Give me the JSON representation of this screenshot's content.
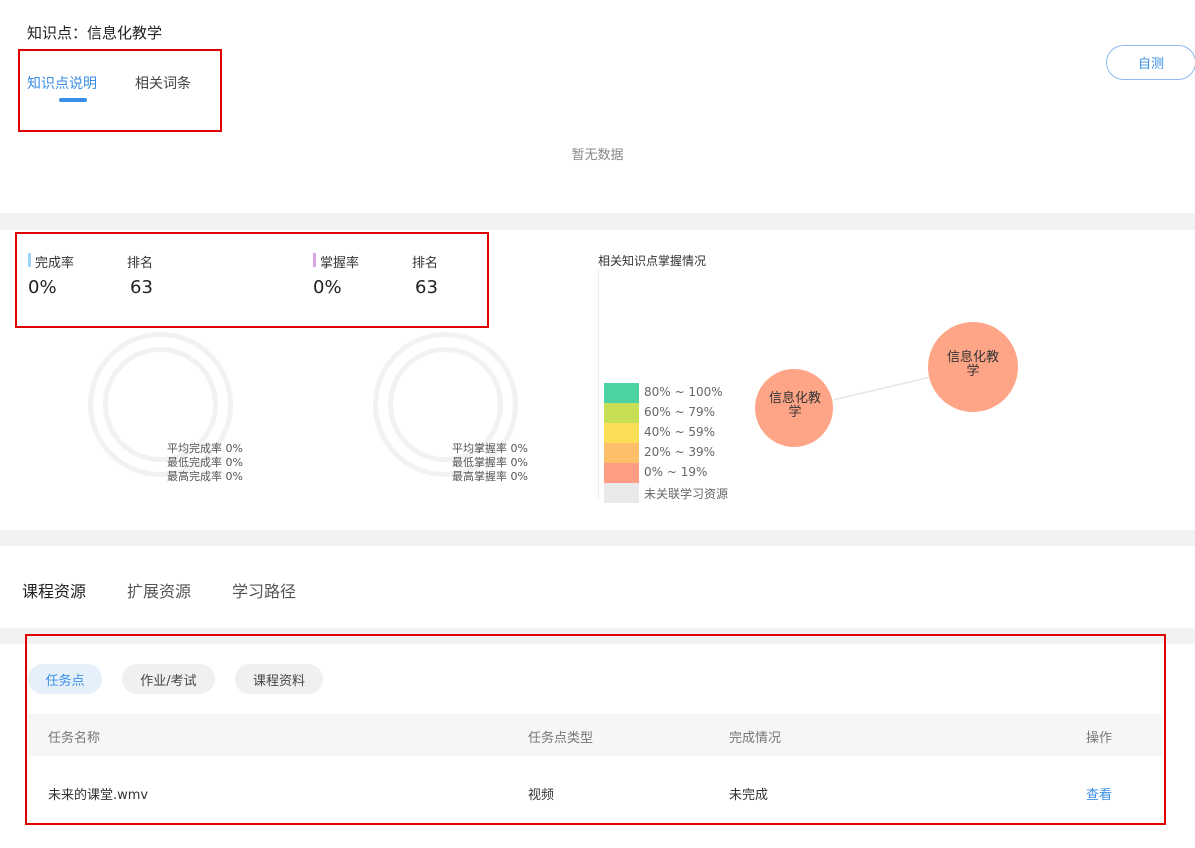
{
  "knowledge_point": {
    "label": "知识点：信息化教学"
  },
  "tabs": [
    {
      "label": "知识点说明",
      "active": true
    },
    {
      "label": "相关词条",
      "active": false
    }
  ],
  "selftest_label": "自测",
  "empty_text": "暂无数据",
  "stats": {
    "completion": {
      "label": "完成率",
      "value": "0%",
      "rank_label": "排名",
      "rank": "63",
      "color": "#9fd3f5"
    },
    "mastery": {
      "label": "掌握率",
      "value": "0%",
      "rank_label": "排名",
      "rank": "63",
      "color": "#d9a3e6"
    }
  },
  "completion_summary": [
    "平均完成率 0%",
    "最低完成率 0%",
    "最高完成率 0%"
  ],
  "mastery_summary": [
    "平均掌握率 0%",
    "最低掌握率 0%",
    "最高掌握率 0%"
  ],
  "related_chart": {
    "title": "相关知识点掌握情况",
    "legend": [
      {
        "label": "80% ~ 100%",
        "color": "#4dd3a1"
      },
      {
        "label": "60% ~ 79%",
        "color": "#c7df55"
      },
      {
        "label": "40% ~ 59%",
        "color": "#fbdf58"
      },
      {
        "label": "20% ~ 39%",
        "color": "#fdbf6a"
      },
      {
        "label": "0% ~ 19%",
        "color": "#fe9d83"
      },
      {
        "label": "未关联学习资源",
        "color": "#e9e9e9"
      }
    ],
    "nodes": [
      {
        "label_line1": "信息化教",
        "label_line2": "学"
      },
      {
        "label_line1": "信息化教",
        "label_line2": "学"
      }
    ],
    "node_color": "#fea587"
  },
  "resource_tabs": [
    {
      "label": "课程资源",
      "active": true
    },
    {
      "label": "扩展资源"
    },
    {
      "label": "学习路径"
    }
  ],
  "filter_pills": [
    {
      "label": "任务点",
      "active": true
    },
    {
      "label": "作业/考试"
    },
    {
      "label": "课程资料"
    }
  ],
  "table": {
    "headers": [
      "任务名称",
      "任务点类型",
      "完成情况",
      "操作"
    ],
    "rows": [
      {
        "name": "未来的课堂.wmv",
        "type": "视频",
        "status": "未完成",
        "action": "查看"
      }
    ]
  }
}
